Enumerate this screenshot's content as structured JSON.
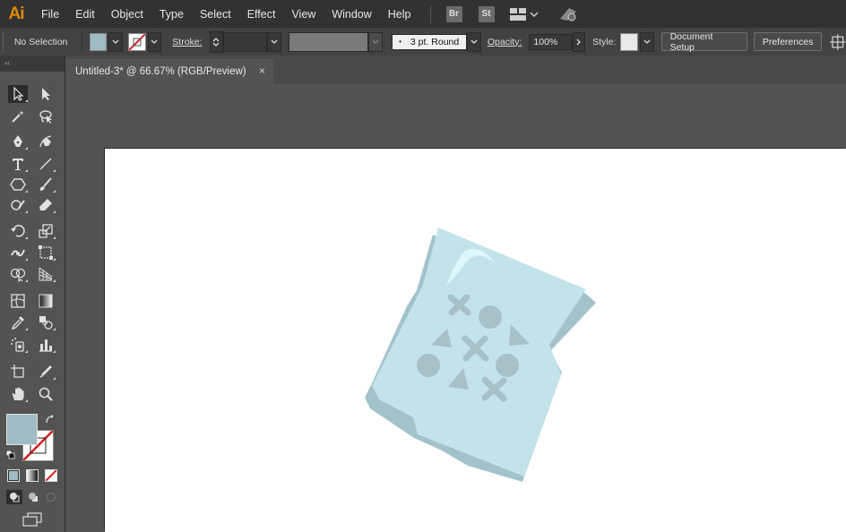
{
  "app": {
    "logo": "Ai"
  },
  "menu": [
    "File",
    "Edit",
    "Object",
    "Type",
    "Select",
    "Effect",
    "View",
    "Window",
    "Help"
  ],
  "menubar_badges": {
    "bridge": "Br",
    "stock": "St"
  },
  "controlbar": {
    "selection_label": "No Selection",
    "stroke_label": "Stroke:",
    "brush_value": "3 pt. Round",
    "opacity_label": "Opacity:",
    "opacity_value": "100%",
    "style_label": "Style:",
    "document_setup": "Document Setup",
    "preferences": "Preferences"
  },
  "colors": {
    "fill_swatch": "#9fbcc4",
    "stroke_none": "#d21f1f",
    "accent_logo": "#ff9a00",
    "artwork_light": "#c3e3ea",
    "artwork_shadow": "#a3c3cb",
    "artwork_highlight": "#def7fb",
    "symbol_color": "#a7c1c7"
  },
  "toolpanel": {
    "collapse_glyph": "‹‹"
  },
  "document": {
    "tab_title": "Untitled-3* @ 66.67% (RGB/Preview)",
    "tab_close": "×"
  }
}
